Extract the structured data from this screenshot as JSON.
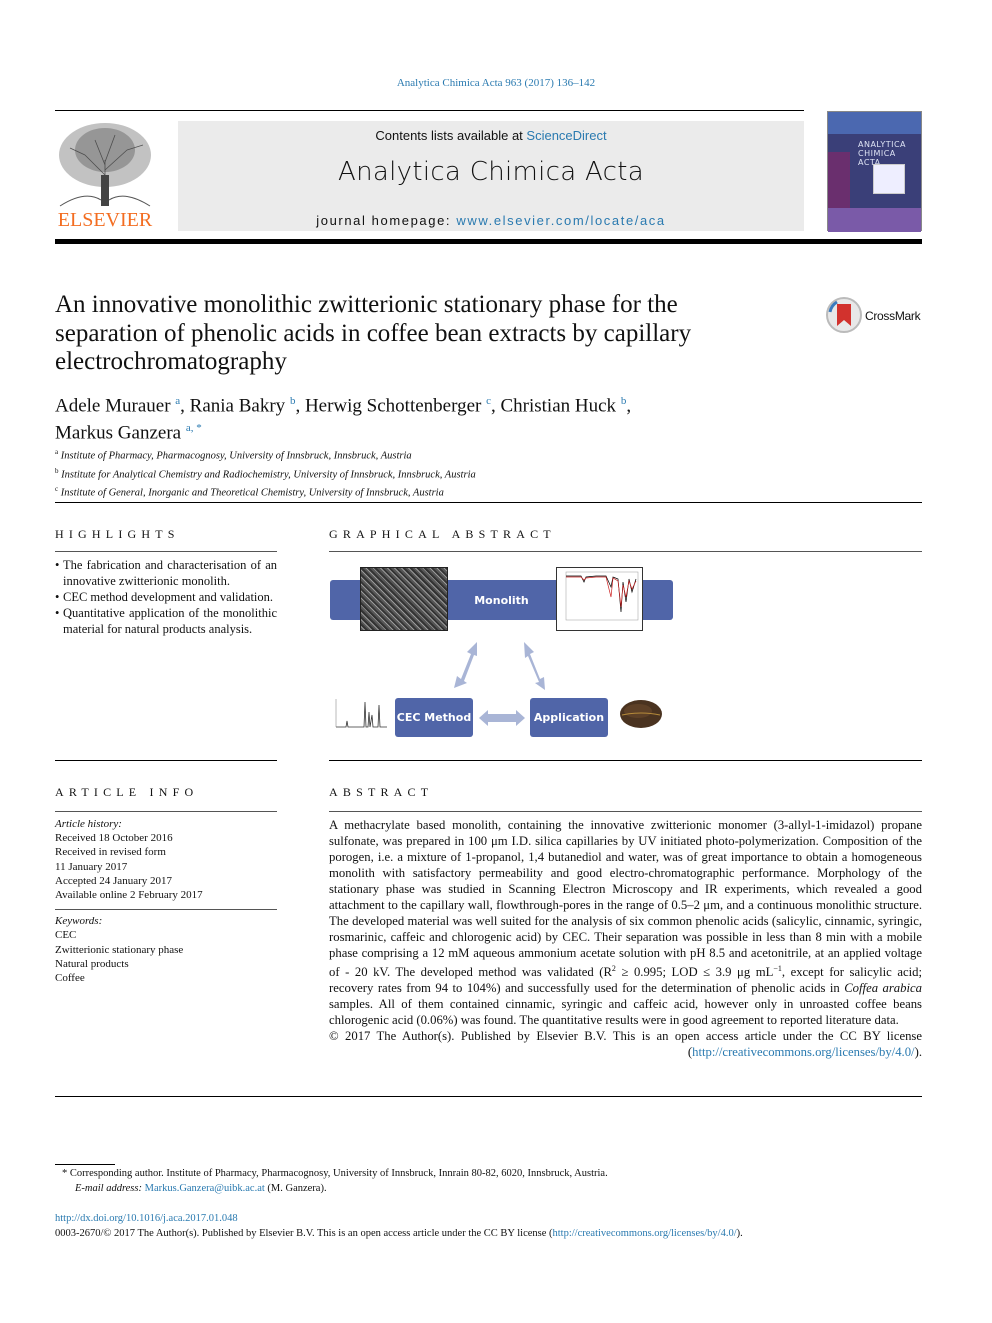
{
  "header": {
    "journal_ref": "Analytica Chimica Acta 963 (2017) 136–142",
    "contents_prefix": "Contents lists available at ",
    "contents_link": "ScienceDirect",
    "journal_title": "Analytica Chimica Acta",
    "homepage_prefix": "journal homepage: ",
    "homepage_link": "www.elsevier.com/locate/aca",
    "publisher_logo": "ELSEVIER",
    "cover_title": "ANALYTICA CHIMICA ACTA"
  },
  "article": {
    "title": "An innovative monolithic zwitterionic stationary phase for the separation of phenolic acids in coffee bean extracts by capillary electrochromatography",
    "crossmark": "CrossMark",
    "authors": [
      {
        "name": "Adele Murauer",
        "sup": "a"
      },
      {
        "name": "Rania Bakry",
        "sup": "b"
      },
      {
        "name": "Herwig Schottenberger",
        "sup": "c"
      },
      {
        "name": "Christian Huck",
        "sup": "b"
      },
      {
        "name": "Markus Ganzera",
        "sup": "a, *"
      }
    ],
    "affiliations": [
      {
        "sup": "a",
        "text": "Institute of Pharmacy, Pharmacognosy, University of Innsbruck, Innsbruck, Austria"
      },
      {
        "sup": "b",
        "text": "Institute for Analytical Chemistry and Radiochemistry, University of Innsbruck, Innsbruck, Austria"
      },
      {
        "sup": "c",
        "text": "Institute of General, Inorganic and Theoretical Chemistry, University of Innsbruck, Austria"
      }
    ]
  },
  "highlights": {
    "heading": "HIGHLIGHTS",
    "items": [
      "The fabrication and characterisation of an innovative zwitterionic monolith.",
      "CEC method development and validation.",
      "Quantitative application of the monolithic material for natural products analysis."
    ]
  },
  "graphical_abstract": {
    "heading": "GRAPHICAL ABSTRACT",
    "monolith": "Monolith",
    "cec_method": "CEC Method",
    "application": "Application",
    "accent": "#5065a8"
  },
  "article_info": {
    "heading": "ARTICLE INFO",
    "history_label": "Article history:",
    "history": [
      "Received 18 October 2016",
      "Received in revised form",
      "11 January 2017",
      "Accepted 24 January 2017",
      "Available online 2 February 2017"
    ],
    "keywords_label": "Keywords:",
    "keywords": [
      "CEC",
      "Zwitterionic stationary phase",
      "Natural products",
      "Coffee"
    ]
  },
  "abstract": {
    "heading": "ABSTRACT",
    "p1": "A methacrylate based monolith, containing the innovative zwitterionic monomer (3-allyl-1-imidazol) propane sulfonate, was prepared in 100 μm I.D. silica capillaries by UV initiated photo-polymerization. Composition of the porogen, i.e. a mixture of 1-propanol, 1,4 butanediol and water, was of great importance to obtain a homogeneous monolith with satisfactory permeability and good electro-chromatographic performance. Morphology of the stationary phase was studied in Scanning Electron Microscopy and IR experiments, which revealed a good attachment to the capillary wall, flowthrough-pores in the range of 0.5–2 μm, and a continuous monolithic structure. The developed material was well suited for the analysis of six common phenolic acids (salicylic, cinnamic, syringic, rosmarinic, caffeic and chlorogenic acid) by CEC. Their separation was possible in less than 8 min with a mobile phase comprising a 12 mM aqueous ammonium acetate solution with pH 8.5 and acetonitrile, at an applied voltage of - 20 kV. The developed method was validated (R",
    "p1_sup1": "2",
    "p1_b": " ≥ 0.995; LOD ≤ 3.9 μg mL",
    "p1_sup2": "−1",
    "p1_c": ", except for salicylic acid; recovery rates from 94 to 104%) and successfully used for the determination of phenolic acids in ",
    "p1_italic": "Coffea arabica",
    "p1_d": " samples. All of them contained cinnamic, syringic and caffeic acid, however only in unroasted coffee beans chlorogenic acid (0.06%) was found. The quantitative results were in good agreement to reported literature data.",
    "copyright": "© 2017 The Author(s). Published by Elsevier B.V. This is an open access article under the CC BY license",
    "license_link": "http://creativecommons.org/licenses/by/4.0/"
  },
  "footer": {
    "corresponding": "* Corresponding author. Institute of Pharmacy, Pharmacognosy, University of Innsbruck, Innrain 80-82, 6020, Innsbruck, Austria.",
    "email_label": "E-mail address:",
    "email": "Markus.Ganzera@uibk.ac.at",
    "email_suffix": " (M. Ganzera).",
    "doi": "http://dx.doi.org/10.1016/j.aca.2017.01.048",
    "license_prefix": "0003-2670/© 2017 The Author(s). Published by Elsevier B.V. This is an open access article under the CC BY license (",
    "license_link": "http://creativecommons.org/licenses/by/4.0/",
    "license_suffix": ")."
  }
}
